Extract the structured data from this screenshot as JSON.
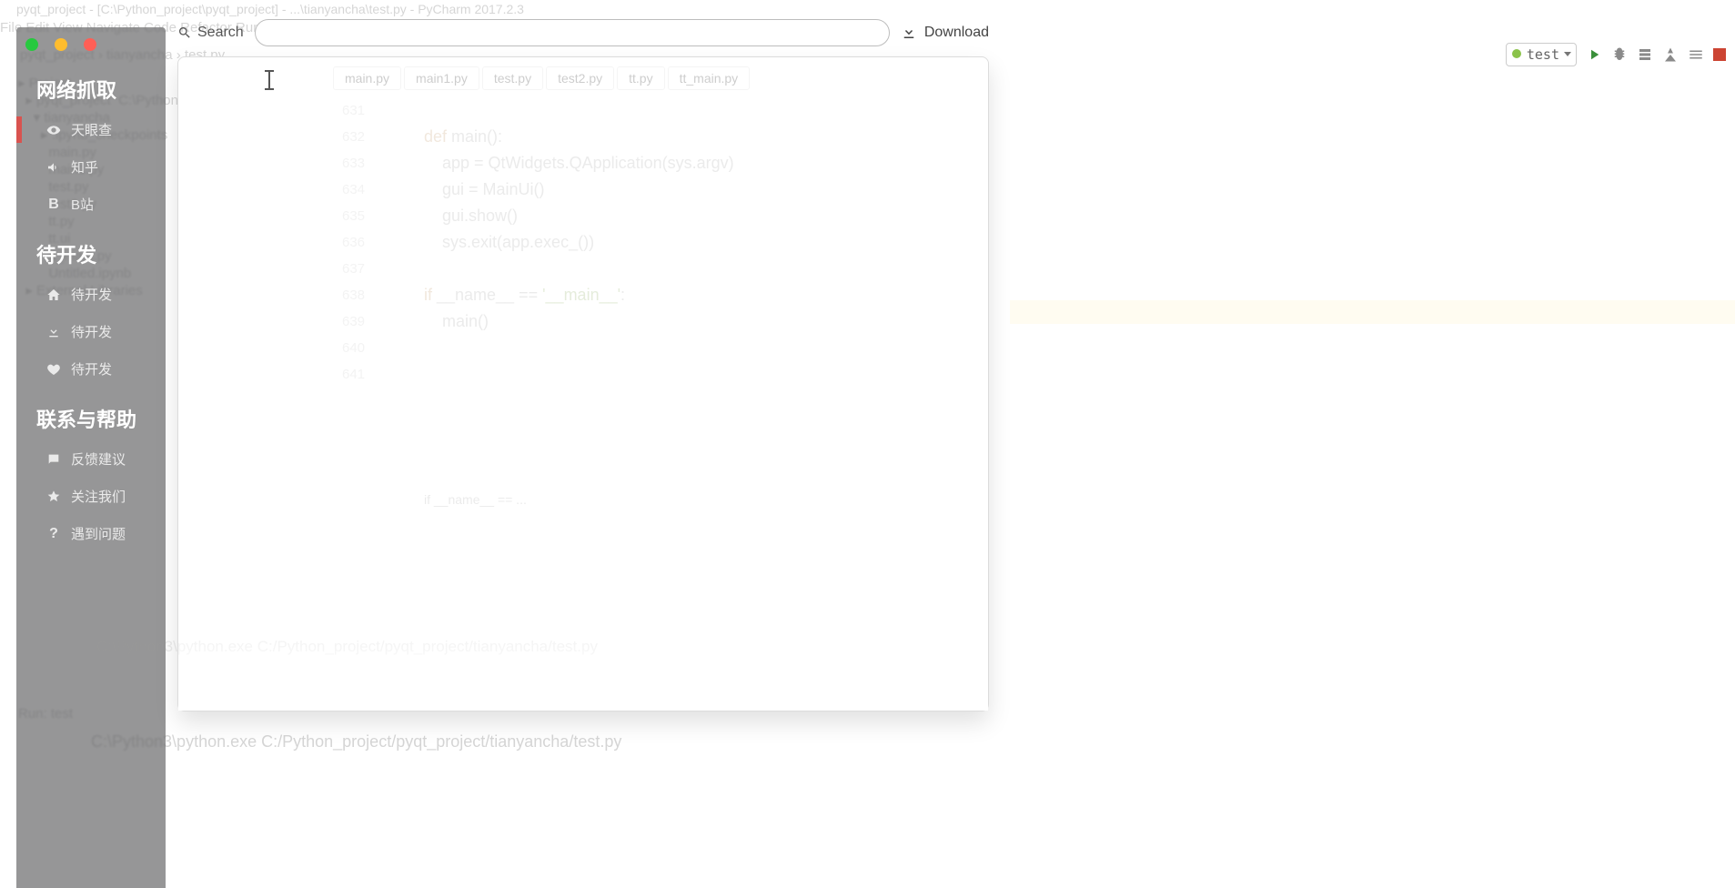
{
  "bg": {
    "title": "pyqt_project - [C:\\Python_project\\pyqt_project] - ...\\tianyancha\\test.py - PyCharm 2017.2.3",
    "menu": "File  Edit  View  Navigate  Code  Refactor  Run  Tools  VCS  Window  Help",
    "crumb": "pyqt_project  ›  tianyancha  ›  test.py",
    "tree": "▸ Project\n  ▸ pyqt_project  C:\\Python_project\\pyqt_project\n    ▾ tianyancha\n      ▸ .ipynb_checkpoints\n        main.py\n        main1.py\n        test.py\n        test2.py\n        tt.py\n        tt.ui\n        tt_main.py\n        Untitled.ipynb\n  ▸ External Libraries",
    "tabs": [
      "main.py",
      "main1.py",
      "test.py",
      "test2.py",
      "tt.py",
      "tt_main.py"
    ],
    "gutter": [
      "631",
      "632",
      "633",
      "634",
      "635",
      "636",
      "637",
      "638",
      "639",
      "640",
      "641"
    ],
    "code": [
      "",
      "<k>def</k> main():",
      "    app = QtWidgets.QApplication(sys.argv)",
      "    gui = MainUi()",
      "    gui.show()",
      "    sys.exit(app.exec_())",
      "",
      "<k>if</k> __name__ == <s>'__main__'</s>:",
      "    main()",
      "",
      ""
    ],
    "runbar": "Run:  test",
    "runout": "C:\\Python3\\python.exe C:/Python_project/pyqt_project/tianyancha/test.py",
    "runconfig": "test"
  },
  "topbar": {
    "search_label": "Search",
    "search_placeholder": "",
    "download_label": "Download"
  },
  "sidebar": {
    "sections": [
      {
        "title": "网络抓取",
        "items": [
          {
            "icon": "eye",
            "label": "天眼查",
            "active": true
          },
          {
            "icon": "bullhorn",
            "label": "知乎"
          },
          {
            "icon": "letter-b",
            "label": "B站"
          }
        ]
      },
      {
        "title": "待开发",
        "items": [
          {
            "icon": "home",
            "label": "待开发"
          },
          {
            "icon": "download",
            "label": "待开发"
          },
          {
            "icon": "heart",
            "label": "待开发"
          }
        ]
      },
      {
        "title": "联系与帮助",
        "items": [
          {
            "icon": "chat",
            "label": "反馈建议"
          },
          {
            "icon": "star",
            "label": "关注我们"
          },
          {
            "icon": "question",
            "label": "遇到问题"
          }
        ]
      }
    ]
  },
  "panel_faded": {
    "tabs": [
      "main.py",
      "main1.py",
      "test.py",
      "test2.py",
      "tt.py",
      "tt_main.py"
    ],
    "gutter": [
      "631",
      "632",
      "633",
      "634",
      "635",
      "636",
      "637",
      "638",
      "639",
      "640",
      "641"
    ],
    "foot": "if __name__ == ...",
    "out": "C:\\Python3\\python.exe C:/Python_project/pyqt_project/tianyancha/test.py"
  }
}
